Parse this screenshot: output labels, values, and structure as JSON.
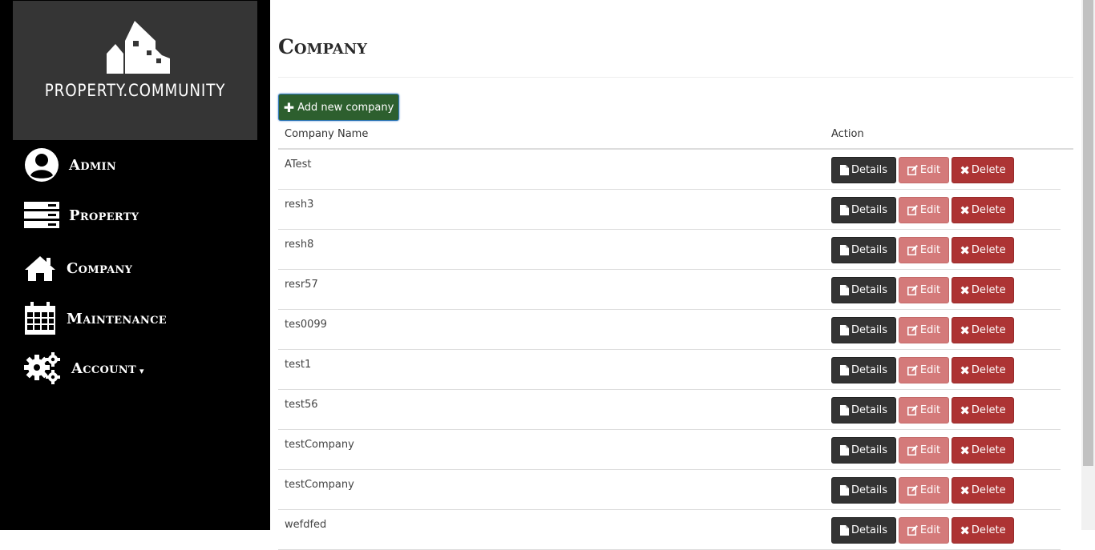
{
  "sidebar": {
    "logo_text": "PROPERTY.COMMUNITY",
    "items": [
      {
        "label": "Admin",
        "icon": "user-circle-icon"
      },
      {
        "label": "Property",
        "icon": "server-icon"
      },
      {
        "label": "Company",
        "icon": "home-icon"
      },
      {
        "label": "Maintenance",
        "icon": "calendar-icon"
      },
      {
        "label": "Account",
        "icon": "gears-icon",
        "has_caret": true
      }
    ]
  },
  "main": {
    "title": "Company",
    "add_button_label": "Add new company",
    "table": {
      "headers": [
        "Company Name",
        "Action"
      ],
      "rows": [
        {
          "name": "ATest"
        },
        {
          "name": "resh3"
        },
        {
          "name": "resh8"
        },
        {
          "name": "resr57"
        },
        {
          "name": "tes0099"
        },
        {
          "name": "test1"
        },
        {
          "name": "test56"
        },
        {
          "name": "testCompany"
        },
        {
          "name": "testCompany"
        },
        {
          "name": "wefdfed"
        }
      ],
      "actions": {
        "details": "Details",
        "edit": "Edit",
        "delete": "Delete"
      }
    }
  },
  "colors": {
    "sidebar_bg": "#000000",
    "logo_bg": "#353535",
    "add_button": "#2d5f2e",
    "details_button": "#333333",
    "edit_button": "#d47a7a",
    "delete_button": "#ad3434"
  }
}
